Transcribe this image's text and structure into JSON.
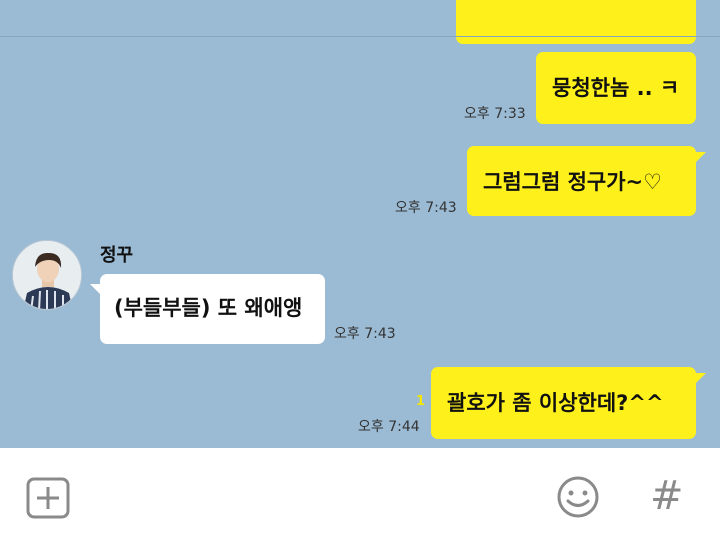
{
  "chat": {
    "messages": [
      {
        "text": "",
        "time": ""
      },
      {
        "text": "뭉청한놈 .. ㅋ",
        "time": "오후 7:33"
      },
      {
        "text": "그럼그럼 정구가~♡",
        "time": "오후 7:43"
      },
      {
        "sender": "정꾸",
        "text": "(부들부들) 또 왜애앵",
        "time": "오후 7:43"
      },
      {
        "text": "괄호가 좀 이상한데?^^",
        "time": "오후 7:44",
        "unread": "1"
      }
    ]
  },
  "input_bar": {
    "add_icon": "plus-square-icon",
    "emoji_icon": "smiley-icon",
    "hash_label": "#"
  },
  "colors": {
    "background": "#9bbbd4",
    "my_bubble": "#fef01b",
    "their_bubble": "#ffffff",
    "icon_gray": "#8a8a8a"
  }
}
